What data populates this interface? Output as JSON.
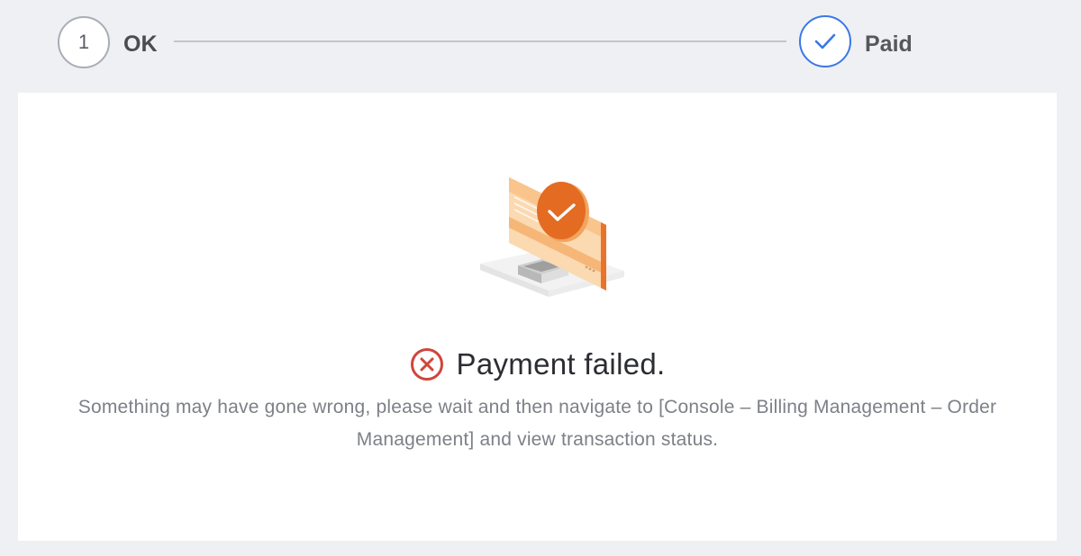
{
  "stepper": {
    "steps": [
      {
        "number": "1",
        "label": "OK",
        "state": "current"
      },
      {
        "number": "",
        "label": "Paid",
        "state": "done",
        "icon": "checkmark-icon"
      }
    ]
  },
  "result": {
    "icon": "error-circle-icon",
    "title": "Payment failed.",
    "description": "Something may have gone wrong, please wait and then navigate to [Console – Billing Management – Order Management] and view transaction status.",
    "illustration": "monitor-payment-illustration"
  },
  "colors": {
    "page_background": "#eff0f4",
    "accent_blue": "#3a78e6",
    "error_red": "#d0453a",
    "illustration_orange": "#e8742c",
    "illustration_light_orange": "#f9cf9d"
  }
}
